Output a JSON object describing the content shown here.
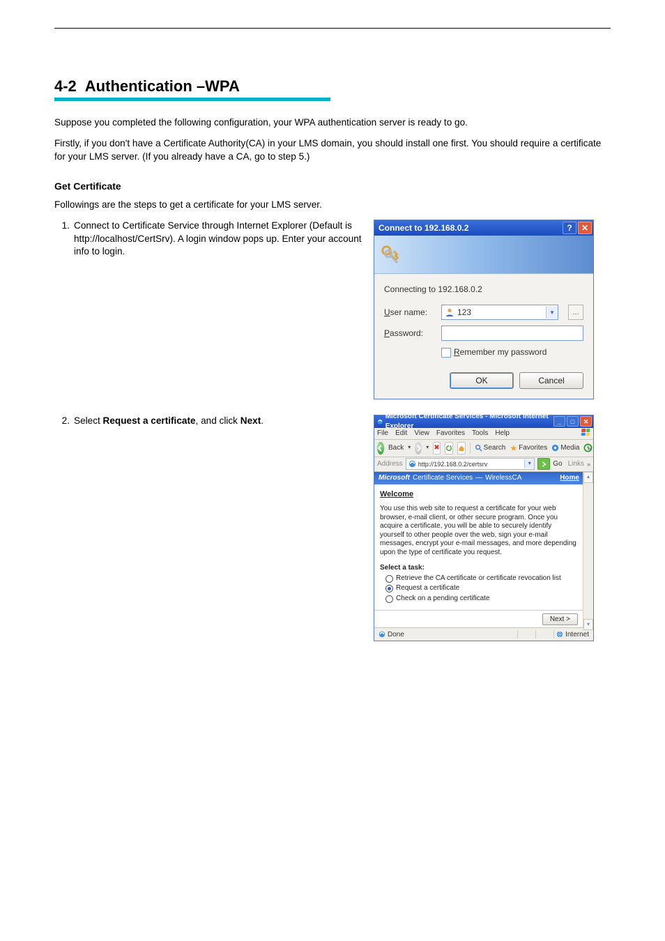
{
  "section": {
    "number": "4-2",
    "title": "Authentication –WPA"
  },
  "intro": [
    "Suppose you completed the following configuration, your WPA authentication server is ready to go.",
    "Firstly, if you don't have a Certificate Authority(CA) in your LMS domain, you should install one first. You should require a certificate for your LMS server. (If you already have a CA, go to step 5.)"
  ],
  "sub1": "Get Certificate",
  "sub2": "Followings are the steps to get a certificate for your LMS server.",
  "step1": {
    "num": "1.",
    "text": "Connect to Certificate Service through Internet Explorer (Default is http://localhost/CertSrv). A login window pops up. Enter your account info to login."
  },
  "step2": {
    "num": "2.",
    "text_a": "Select",
    "bold": " Request a certificate",
    "text_b": ", and click",
    "next": " Next",
    "period": "."
  },
  "dlg1": {
    "title": "Connect to 192.168.0.2",
    "connecting": "Connecting to 192.168.0.2",
    "user_label": "User name:",
    "user_value": "123",
    "pass_label": "Password:",
    "remember": "Remember my password",
    "ok": "OK",
    "cancel": "Cancel"
  },
  "ie": {
    "title_prefix": "Microsoft Certificate Services - Microsoft Internet Explorer",
    "menus": [
      "File",
      "Edit",
      "View",
      "Favorites",
      "Tools",
      "Help"
    ],
    "back": "Back",
    "toolbar_search": "Search",
    "toolbar_fav": "Favorites",
    "toolbar_media": "Media",
    "addr_label": "Address",
    "addr_value": "http://192.168.0.2/certsrv",
    "go": "Go",
    "links": "Links",
    "headband_prefix": "Microsoft",
    "headband_mid": "Certificate Services",
    "headband_dash": " — ",
    "headband_ca": "WirelessCA",
    "home": "Home",
    "welcome": "Welcome",
    "blurb": "You use this web site to request a certificate for your web browser, e-mail client, or other secure program. Once you acquire a certificate, you will be able to securely identify yourself to other people over the web, sign your e-mail messages, encrypt your e-mail messages, and more depending upon the type of certificate you request.",
    "select_task": "Select a task:",
    "opt1": "Retrieve the CA certificate or certificate revocation list",
    "opt2": "Request a certificate",
    "opt3": "Check on a pending certificate",
    "next_btn": "Next >",
    "status_done": "Done",
    "status_zone": "Internet"
  }
}
